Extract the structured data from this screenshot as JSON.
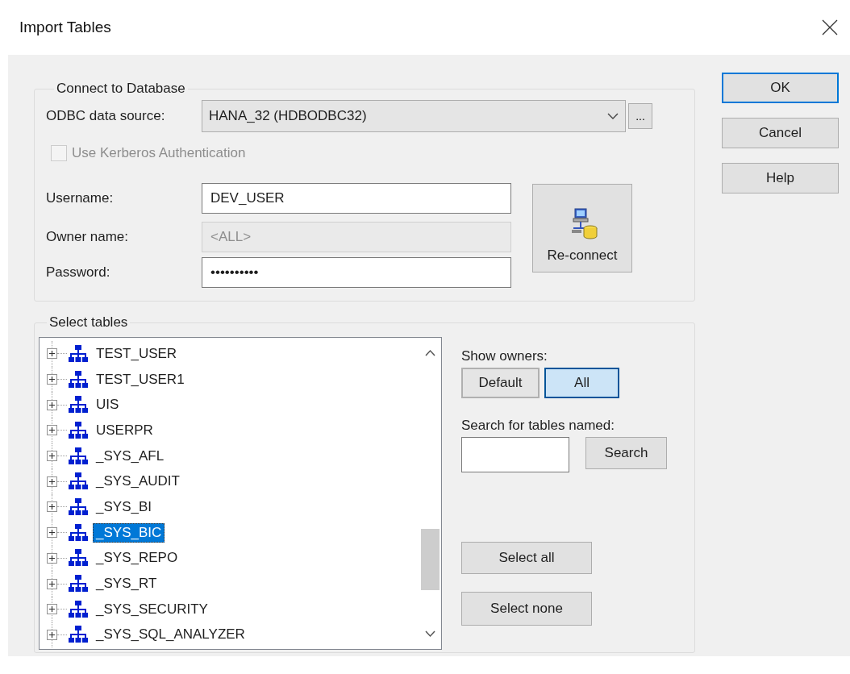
{
  "window": {
    "title": "Import Tables"
  },
  "connect_group": {
    "title": "Connect to Database",
    "odbc_label": "ODBC data source:",
    "odbc_value": "HANA_32 (HDBODBC32)",
    "browse_button": "...",
    "kerberos": {
      "label": "Use Kerberos Authentication",
      "checked": false,
      "disabled": true
    },
    "username": {
      "label": "Username:",
      "value": "DEV_USER",
      "disabled": false
    },
    "owner_name": {
      "label": "Owner name:",
      "value": "<ALL>",
      "disabled": true
    },
    "password": {
      "label": "Password:",
      "value": "••••••••••",
      "disabled": false
    },
    "reconnect_button": "Re-connect"
  },
  "select_group": {
    "title": "Select tables",
    "tree": [
      {
        "label": "TEST_USER",
        "selected": false,
        "expanded": false
      },
      {
        "label": "TEST_USER1",
        "selected": false,
        "expanded": false
      },
      {
        "label": "UIS",
        "selected": false,
        "expanded": false
      },
      {
        "label": "USERPR",
        "selected": false,
        "expanded": false
      },
      {
        "label": "_SYS_AFL",
        "selected": false,
        "expanded": false
      },
      {
        "label": "_SYS_AUDIT",
        "selected": false,
        "expanded": false
      },
      {
        "label": "_SYS_BI",
        "selected": false,
        "expanded": false
      },
      {
        "label": "_SYS_BIC",
        "selected": true,
        "expanded": false
      },
      {
        "label": "_SYS_REPO",
        "selected": false,
        "expanded": false
      },
      {
        "label": "_SYS_RT",
        "selected": false,
        "expanded": false
      },
      {
        "label": "_SYS_SECURITY",
        "selected": false,
        "expanded": false
      },
      {
        "label": "_SYS_SQL_ANALYZER",
        "selected": false,
        "expanded": false
      }
    ],
    "show_owners": {
      "label": "Show owners:",
      "options": [
        {
          "label": "Default",
          "selected": false
        },
        {
          "label": "All",
          "selected": true
        }
      ]
    },
    "search": {
      "label": "Search for tables named:",
      "button": "Search"
    },
    "select_all": "Select all",
    "select_none": "Select none"
  },
  "buttons": [
    {
      "label": "OK",
      "default": true
    },
    {
      "label": "Cancel",
      "default": false
    },
    {
      "label": "Help",
      "default": false
    }
  ]
}
